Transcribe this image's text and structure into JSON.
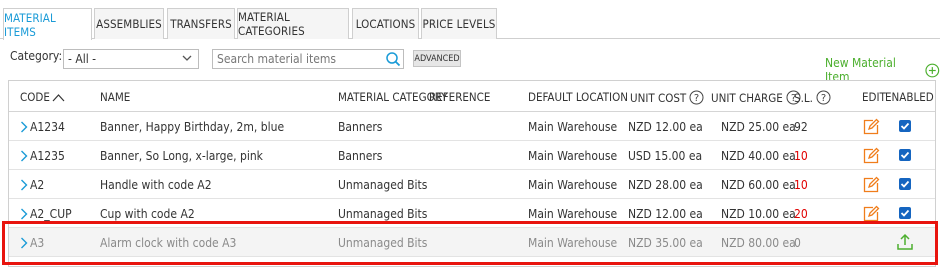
{
  "tabs": [
    {
      "label": "MATERIAL ITEMS",
      "active": true
    },
    {
      "label": "ASSEMBLIES",
      "active": false
    },
    {
      "label": "TRANSFERS",
      "active": false
    },
    {
      "label": "MATERIAL CATEGORIES",
      "active": false
    },
    {
      "label": "LOCATIONS",
      "active": false
    },
    {
      "label": "PRICE LEVELS",
      "active": false
    }
  ],
  "filters": {
    "category_label": "Category:",
    "category_value": "- All -",
    "search_placeholder": "Search material items",
    "advanced_label": "ADVANCED"
  },
  "new_item_label": "New Material Item",
  "columns": {
    "code": "CODE",
    "name": "NAME",
    "category": "MATERIAL CATEGORY",
    "reference": "REFERENCE",
    "location": "DEFAULT LOCATION",
    "unit_cost": "UNIT COST",
    "unit_charge": "UNIT CHARGE",
    "sl": "S.L.",
    "edit": "EDIT",
    "enabled": "ENABLED"
  },
  "rows": [
    {
      "code": "A1234",
      "name": "Banner, Happy Birthday, 2m, blue",
      "category": "Banners",
      "location": "Main Warehouse",
      "unit_cost": "NZD 12.00 ea",
      "unit_charge": "NZD 25.00 ea",
      "sl": "92",
      "sl_low": false,
      "enabled": true
    },
    {
      "code": "A1235",
      "name": "Banner, So Long, x-large, pink",
      "category": "Banners",
      "location": "Main Warehouse",
      "unit_cost": "USD 15.00 ea",
      "unit_charge": "NZD 40.00 ea",
      "sl": "10",
      "sl_low": true,
      "enabled": true
    },
    {
      "code": "A2",
      "name": "Handle with code A2",
      "category": "Unmanaged Bits",
      "location": "Main Warehouse",
      "unit_cost": "NZD 28.00 ea",
      "unit_charge": "NZD 60.00 ea",
      "sl": "10",
      "sl_low": true,
      "enabled": true
    },
    {
      "code": "A2_CUP",
      "name": "Cup with code A2",
      "category": "Unmanaged Bits",
      "location": "Main Warehouse",
      "unit_cost": "NZD 12.00 ea",
      "unit_charge": "NZD 10.00 ea",
      "sl": "20",
      "sl_low": true,
      "enabled": true
    },
    {
      "code": "A3",
      "name": "Alarm clock with code A3",
      "category": "Unmanaged Bits",
      "location": "Main Warehouse",
      "unit_cost": "NZD 35.00 ea",
      "unit_charge": "NZD 80.00 ea",
      "sl": "0",
      "sl_low": false,
      "enabled": false
    }
  ],
  "colors": {
    "accent": "#1a9bd7",
    "new_item_green": "#4caf2e",
    "edit_orange": "#f07d1b",
    "checkbox_blue": "#1565c0",
    "low_stock_red": "#e00000",
    "highlight_red": "#e8140e"
  },
  "icons": {
    "sort": "sort-up-icon",
    "help": "help-circle-icon",
    "edit": "edit-icon",
    "add": "plus-circle-icon",
    "expand": "chevron-right-icon",
    "search": "search-icon",
    "import": "upload-icon"
  }
}
